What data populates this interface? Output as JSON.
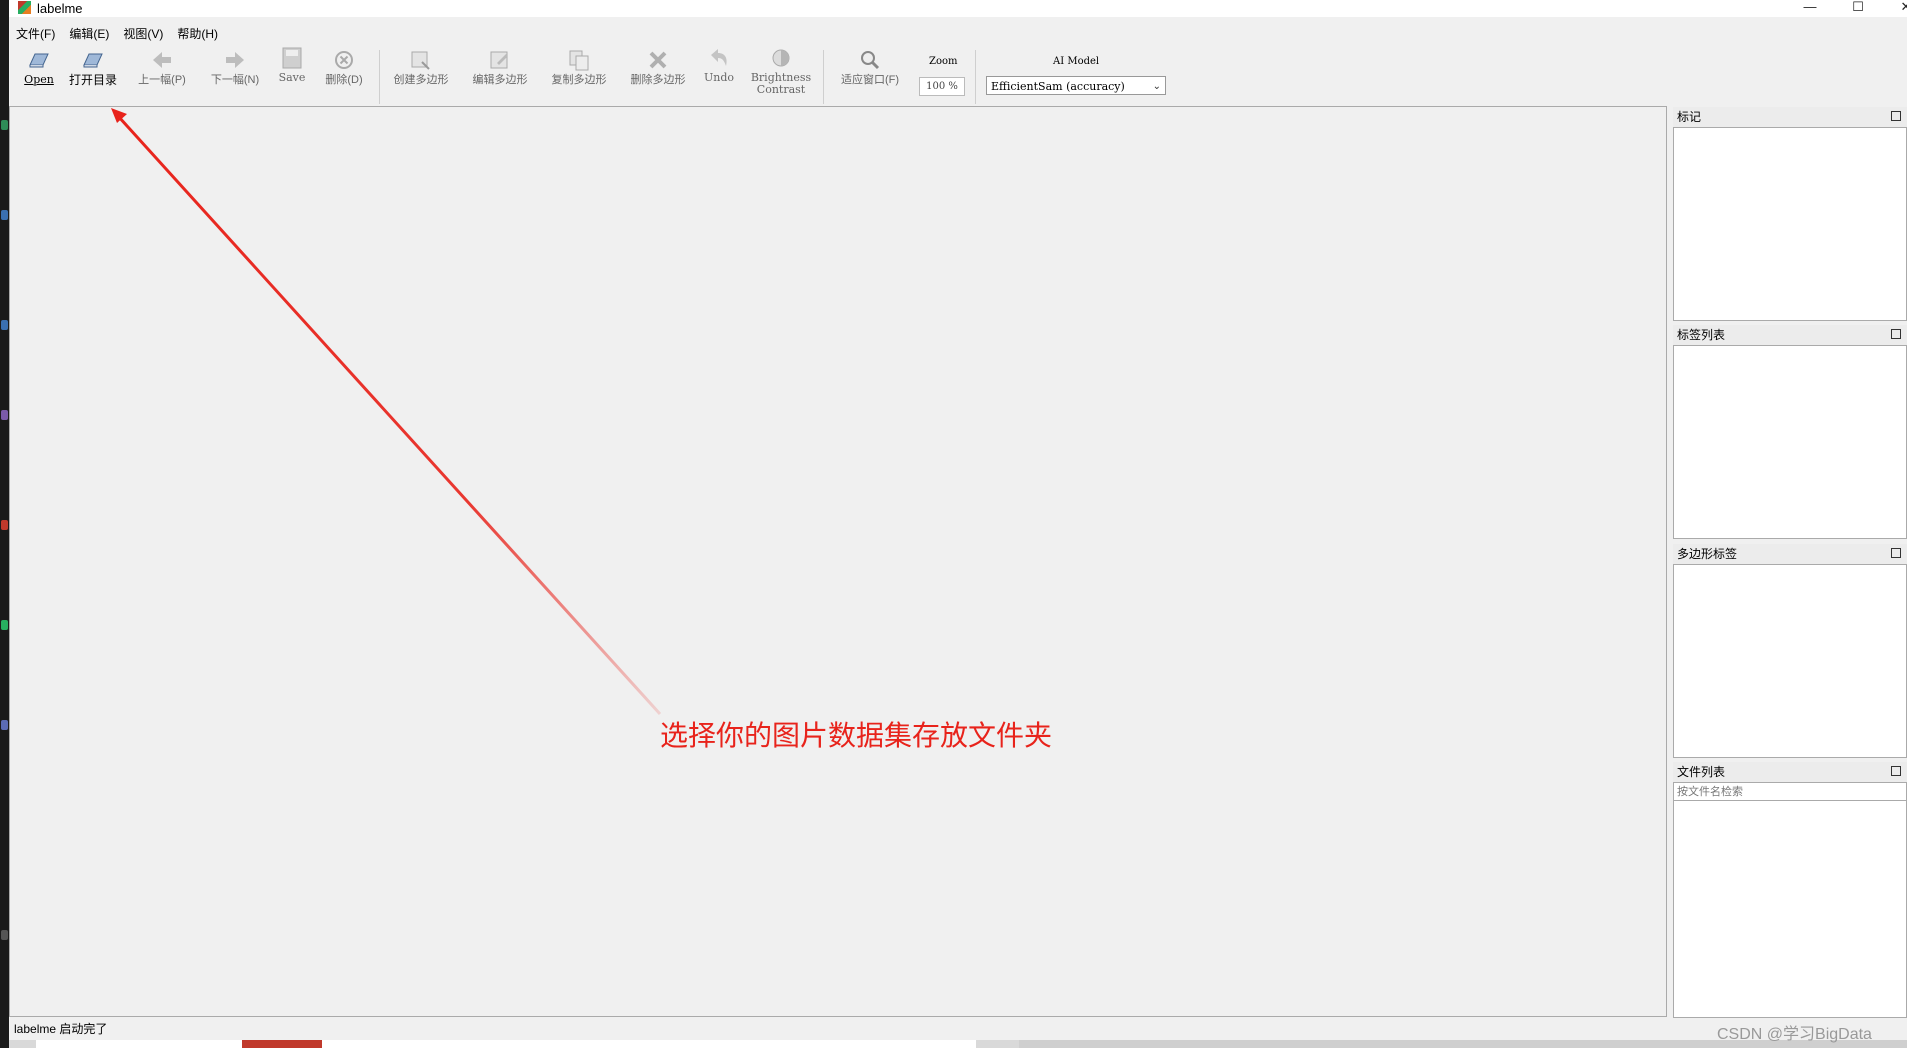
{
  "window": {
    "title": "labelme",
    "minimize_glyph": "—",
    "maximize_glyph": "☐",
    "close_glyph": "✕"
  },
  "menubar": {
    "items": [
      "文件(F)",
      "编辑(E)",
      "视图(V)",
      "帮助(H)"
    ]
  },
  "toolbar": {
    "open": "Open",
    "open_dir": "打开目录",
    "prev": "上一幅(P)",
    "next": "下一幅(N)",
    "save": "Save",
    "delete": "删除(D)",
    "create_polygon": "创建多边形",
    "edit_polygon": "编辑多边形",
    "copy_polygon": "复制多边形",
    "delete_polygon": "删除多边形",
    "undo": "Undo",
    "brightness_line1": "Brightness",
    "brightness_line2": "Contrast",
    "fit_window": "适应窗口(F)",
    "zoom_label": "Zoom",
    "zoom_value": "100 %",
    "ai_model_label": "AI Model",
    "ai_model_value": "EfficientSam (accuracy)"
  },
  "docks": {
    "flags": "标记",
    "label_list": "标签列表",
    "polygon_labels": "多边形标签",
    "file_list": "文件列表",
    "file_search_placeholder": "按文件名检索"
  },
  "status": {
    "message": "labelme 启动完了"
  },
  "annotation": {
    "text": "选择你的图片数据集存放文件夹",
    "color": "#e8231b"
  },
  "watermark": "CSDN @学习BigData",
  "colors": {
    "background": "#f0f0f0",
    "panel_white": "#ffffff",
    "annotation_red": "#e8231b"
  }
}
